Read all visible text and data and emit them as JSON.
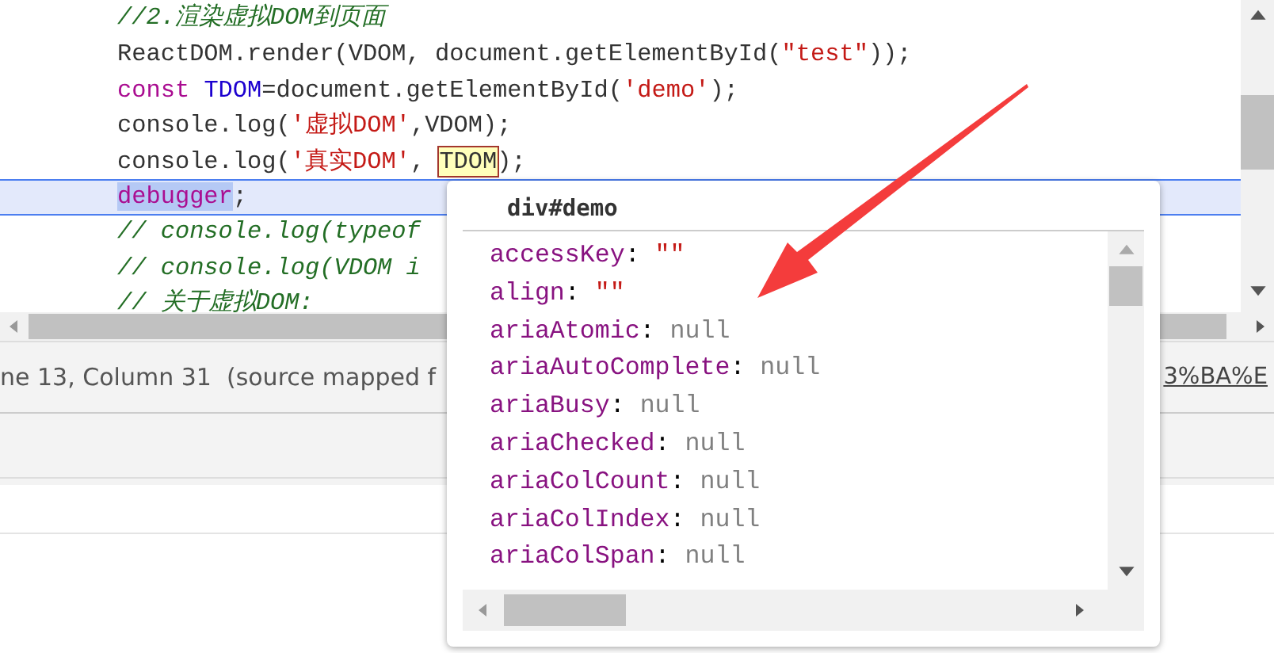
{
  "editor": {
    "lines": [
      {
        "paused": false,
        "tokens": [
          {
            "kind": "comment",
            "text": "//2.渲染虚拟DOM到页面"
          }
        ]
      },
      {
        "paused": false,
        "tokens": [
          {
            "kind": "plain",
            "text": "ReactDOM.render(VDOM, document.getElementById("
          },
          {
            "kind": "string",
            "text": "\"test\""
          },
          {
            "kind": "plain",
            "text": "));"
          }
        ]
      },
      {
        "paused": false,
        "tokens": [
          {
            "kind": "keyword",
            "text": "const "
          },
          {
            "kind": "def",
            "text": "TDOM"
          },
          {
            "kind": "plain",
            "text": "=document.getElementById("
          },
          {
            "kind": "string",
            "text": "'demo'"
          },
          {
            "kind": "plain",
            "text": ");"
          }
        ]
      },
      {
        "paused": false,
        "tokens": [
          {
            "kind": "plain",
            "text": "console.log("
          },
          {
            "kind": "string",
            "text": "'虚拟DOM'"
          },
          {
            "kind": "plain",
            "text": ",VDOM);"
          }
        ]
      },
      {
        "paused": false,
        "tokens": [
          {
            "kind": "plain",
            "text": "console.log("
          },
          {
            "kind": "string",
            "text": "'真实DOM'"
          },
          {
            "kind": "plain",
            "text": ", "
          },
          {
            "kind": "hovered",
            "text": "TDOM"
          },
          {
            "kind": "plain",
            "text": ");"
          }
        ]
      },
      {
        "paused": true,
        "tokens": [
          {
            "kind": "selected",
            "text": "debugger"
          },
          {
            "kind": "plain",
            "text": ";"
          }
        ]
      },
      {
        "paused": false,
        "tokens": [
          {
            "kind": "comment",
            "text": "// console.log(typeof"
          }
        ]
      },
      {
        "paused": false,
        "tokens": [
          {
            "kind": "comment",
            "text": "// console.log(VDOM i"
          }
        ]
      },
      {
        "paused": false,
        "tokens": [
          {
            "kind": "comment",
            "text": "// 关于虚拟DOM:"
          }
        ]
      }
    ]
  },
  "status_bar": {
    "position": "ne 13, Column 31  (source mapped f",
    "link": "3%BA%E"
  },
  "tooltip": {
    "title": "div#demo",
    "properties": [
      {
        "name": "accessKey",
        "separator": ":",
        "value": "\"\"",
        "kind": "string"
      },
      {
        "name": "align",
        "separator": ":",
        "value": "\"\"",
        "kind": "string"
      },
      {
        "name": "ariaAtomic",
        "separator": ":",
        "value": "null",
        "kind": "null"
      },
      {
        "name": "ariaAutoComplete",
        "separator": ":",
        "value": "null",
        "kind": "null"
      },
      {
        "name": "ariaBusy",
        "separator": ":",
        "value": "null",
        "kind": "null"
      },
      {
        "name": "ariaChecked",
        "separator": ":",
        "value": "null",
        "kind": "null"
      },
      {
        "name": "ariaColCount",
        "separator": ":",
        "value": "null",
        "kind": "null"
      },
      {
        "name": "ariaColIndex",
        "separator": ":",
        "value": "null",
        "kind": "null"
      },
      {
        "name": "ariaColSpan",
        "separator": ":",
        "value": "null",
        "kind": "null"
      }
    ]
  }
}
